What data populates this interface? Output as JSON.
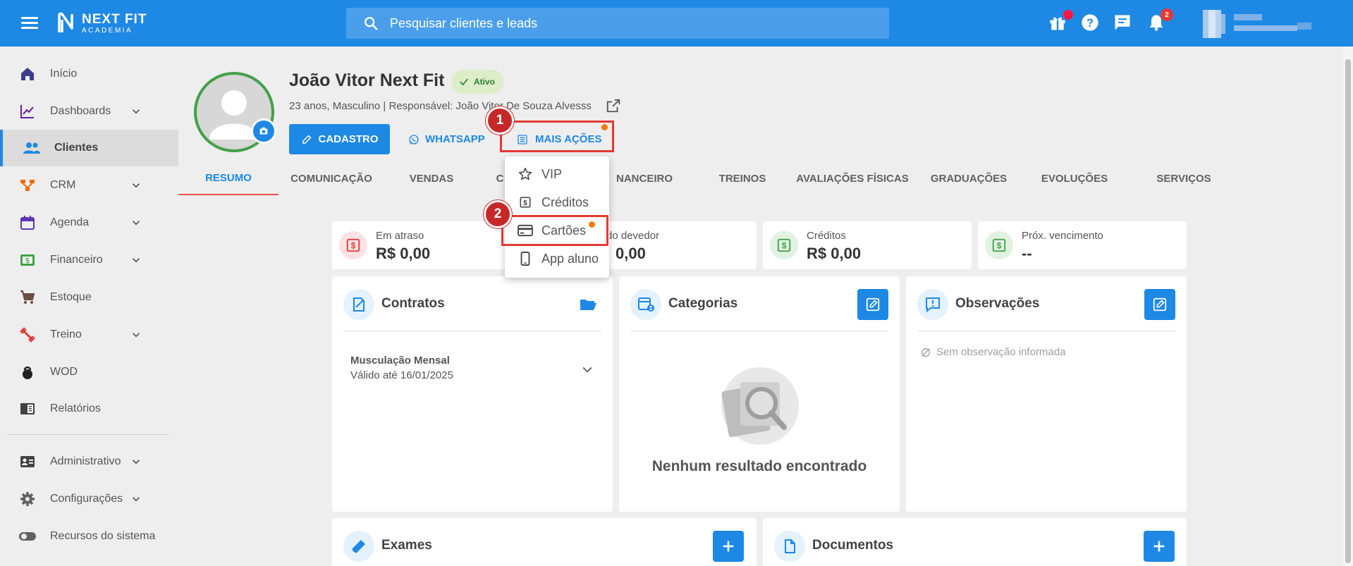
{
  "topbar": {
    "logo_line1": "NEXT FIT",
    "logo_line2": "ACADEMIA",
    "search_placeholder": "Pesquisar clientes e leads",
    "notifications_count": "2"
  },
  "sidebar": {
    "items": [
      {
        "label": "Início"
      },
      {
        "label": "Dashboards"
      },
      {
        "label": "Clientes"
      },
      {
        "label": "CRM"
      },
      {
        "label": "Agenda"
      },
      {
        "label": "Financeiro"
      },
      {
        "label": "Estoque"
      },
      {
        "label": "Treino"
      },
      {
        "label": "WOD"
      },
      {
        "label": "Relatórios"
      },
      {
        "label": "Administrativo"
      },
      {
        "label": "Configurações"
      },
      {
        "label": "Recursos do sistema"
      }
    ]
  },
  "client": {
    "name": "João Vitor Next Fit",
    "status": "Ativo",
    "info": "23 anos, Masculino | Responsável: João Vitor De Souza Alvesss"
  },
  "actions": {
    "cadastro": "CADASTRO",
    "whatsapp": "WHATSAPP",
    "mais_acoes": "MAIS AÇÕES"
  },
  "steps": {
    "one": "1",
    "two": "2"
  },
  "tabs": [
    {
      "label": "RESUMO"
    },
    {
      "label": "COMUNICAÇÃO"
    },
    {
      "label": "VENDAS"
    },
    {
      "label": "C"
    },
    {
      "label": "NANCEIRO"
    },
    {
      "label": "TREINOS"
    },
    {
      "label": "AVALIAÇÕES FÍSICAS"
    },
    {
      "label": "GRADUAÇÕES"
    },
    {
      "label": "EVOLUÇÕES"
    },
    {
      "label": "SERVIÇOS"
    }
  ],
  "dropdown": {
    "items": [
      {
        "label": "VIP"
      },
      {
        "label": "Créditos"
      },
      {
        "label": "Cartões"
      },
      {
        "label": "App aluno"
      }
    ]
  },
  "stats": [
    {
      "label": "Em atraso",
      "value": "R$ 0,00"
    },
    {
      "label": "do devedor",
      "value": "0,00"
    },
    {
      "label": "Créditos",
      "value": "R$ 0,00"
    },
    {
      "label": "Próx. vencimento",
      "value": "--"
    }
  ],
  "panels": {
    "contratos": {
      "title": "Contratos",
      "contract_name": "Musculação Mensal",
      "contract_valid": "Válido até 16/01/2025"
    },
    "categorias": {
      "title": "Categorias",
      "empty": "Nenhum resultado encontrado"
    },
    "observacoes": {
      "title": "Observações",
      "empty": "Sem observação informada"
    },
    "exames": {
      "title": "Exames"
    },
    "documentos": {
      "title": "Documentos"
    }
  },
  "colors": {
    "primary": "#1e88e5",
    "active_green": "#43a047",
    "highlight_red": "#e53935",
    "notice_orange": "#f57c00"
  }
}
